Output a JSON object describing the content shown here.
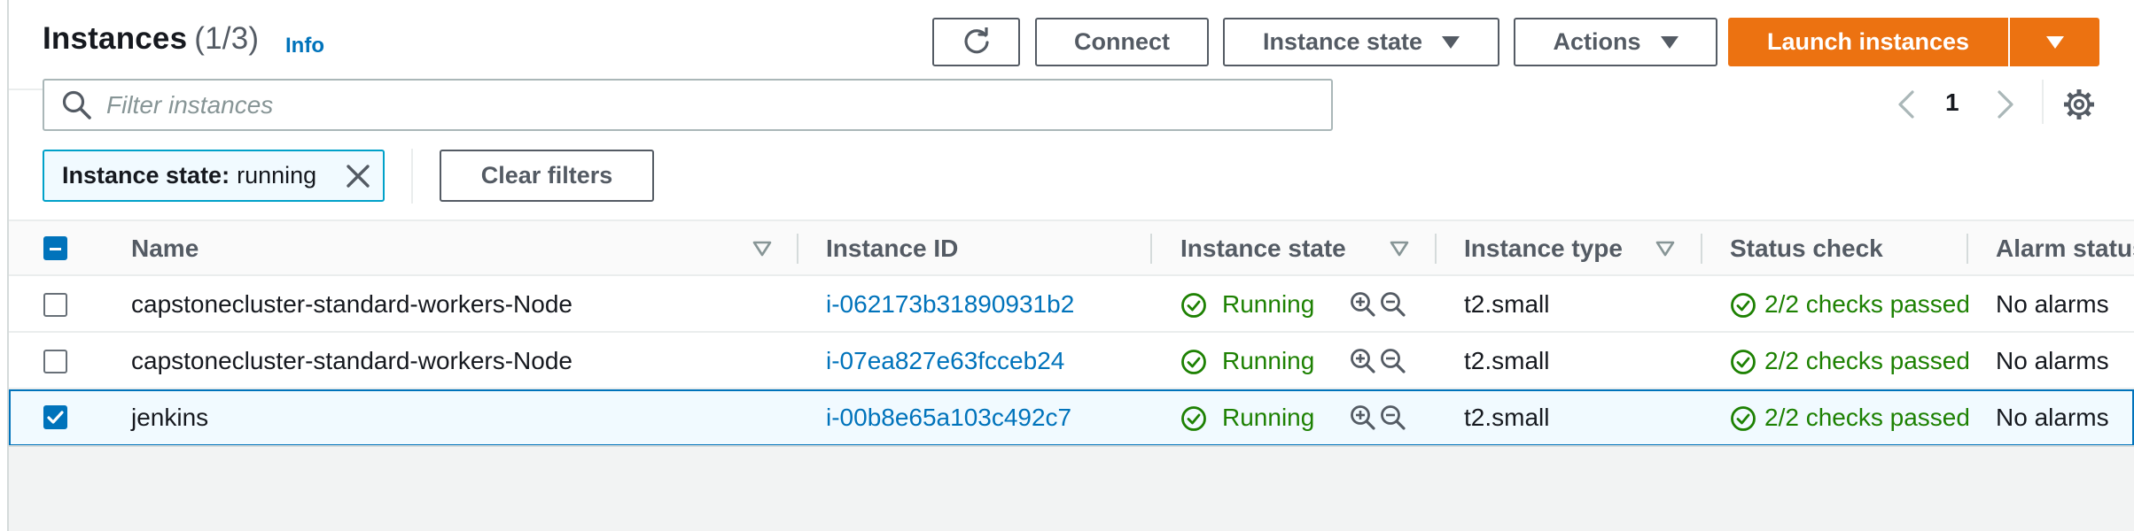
{
  "header": {
    "title": "Instances",
    "count": "(1/3)",
    "info": "Info"
  },
  "toolbar": {
    "refresh_icon": "refresh-icon",
    "connect_label": "Connect",
    "instance_state_label": "Instance state",
    "actions_label": "Actions",
    "launch_label": "Launch instances"
  },
  "filter": {
    "placeholder": "Filter instances",
    "value": "",
    "token_key": "Instance state:",
    "token_value": "running",
    "clear_label": "Clear filters"
  },
  "pagination": {
    "page": "1"
  },
  "colors": {
    "primary": "#ec7211",
    "link": "#0073bb",
    "success": "#1d8102",
    "selected_bg": "#f1faff"
  },
  "table": {
    "columns": [
      "Name",
      "Instance ID",
      "Instance state",
      "Instance type",
      "Status check",
      "Alarm status"
    ],
    "rows": [
      {
        "selected": false,
        "name": "capstonecluster-standard-workers-Node",
        "instance_id": "i-062173b31890931b2",
        "state": "Running",
        "type": "t2.small",
        "status_check": "2/2 checks passed",
        "alarm": "No alarms"
      },
      {
        "selected": false,
        "name": "capstonecluster-standard-workers-Node",
        "instance_id": "i-07ea827e63fcceb24",
        "state": "Running",
        "type": "t2.small",
        "status_check": "2/2 checks passed",
        "alarm": "No alarms"
      },
      {
        "selected": true,
        "name": "jenkins",
        "instance_id": "i-00b8e65a103c492c7",
        "state": "Running",
        "type": "t2.small",
        "status_check": "2/2 checks passed",
        "alarm": "No alarms"
      }
    ]
  }
}
